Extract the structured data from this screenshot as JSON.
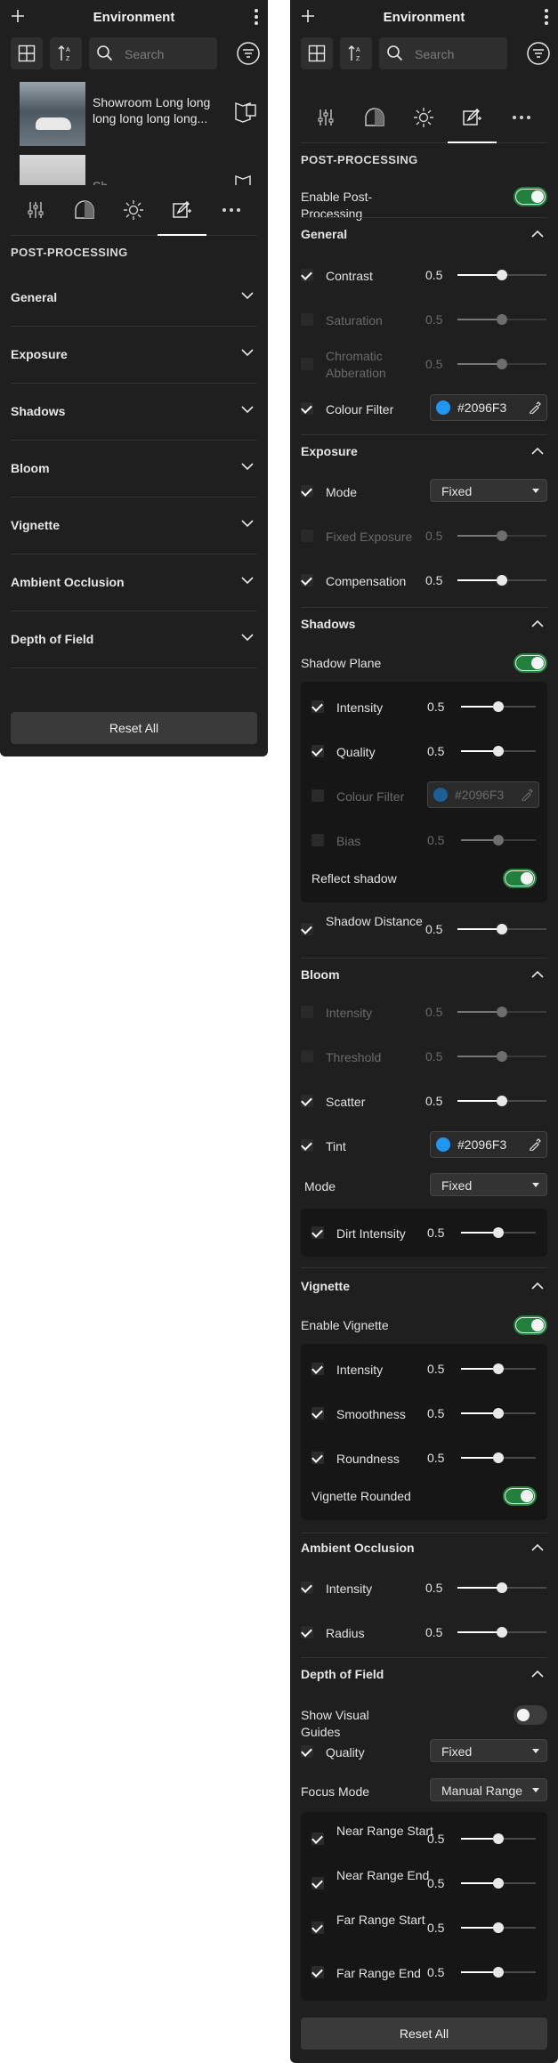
{
  "header": {
    "title": "Environment",
    "search_placeholder": "Search"
  },
  "environment_list": [
    {
      "name": "Showroom Long long long long long long..."
    },
    {
      "name": "Sh..."
    }
  ],
  "section_title": "POST-PROCESSING",
  "left_sections": [
    "General",
    "Exposure",
    "Shadows",
    "Bloom",
    "Vignette",
    "Ambient Occlusion",
    "Depth of Field"
  ],
  "reset_label": "Reset All",
  "right": {
    "enable_pp_label": "Enable Post-Processing",
    "general": {
      "title": "General",
      "rows": [
        {
          "label": "Contrast",
          "value": "0.5",
          "checked": true,
          "enabled": true
        },
        {
          "label": "Saturation",
          "value": "0.5",
          "checked": false,
          "enabled": false
        },
        {
          "label": "Chromatic Abberation",
          "value": "0.5",
          "checked": false,
          "enabled": false
        },
        {
          "label": "Colour Filter",
          "color": "#2096F3",
          "checked": true,
          "enabled": true
        }
      ]
    },
    "exposure": {
      "title": "Exposure",
      "mode_label": "Mode",
      "mode_value": "Fixed",
      "fixed_exposure_label": "Fixed Exposure",
      "fixed_exposure_value": "0.5",
      "compensation_label": "Compensation",
      "compensation_value": "0.5"
    },
    "shadows": {
      "title": "Shadows",
      "plane_label": "Shadow Plane",
      "intensity_label": "Intensity",
      "intensity_value": "0.5",
      "quality_label": "Quality",
      "quality_value": "0.5",
      "colour_filter_label": "Colour Filter",
      "colour_filter_value": "#2096F3",
      "bias_label": "Bias",
      "bias_value": "0.5",
      "reflect_label": "Reflect shadow",
      "distance_label": "Shadow Distance",
      "distance_value": "0.5"
    },
    "bloom": {
      "title": "Bloom",
      "intensity_label": "Intensity",
      "intensity_value": "0.5",
      "threshold_label": "Threshold",
      "threshold_value": "0.5",
      "scatter_label": "Scatter",
      "scatter_value": "0.5",
      "tint_label": "Tint",
      "tint_value": "#2096F3",
      "mode_label": "Mode",
      "mode_value": "Fixed",
      "dirt_label": "Dirt Intensity",
      "dirt_value": "0.5"
    },
    "vignette": {
      "title": "Vignette",
      "enable_label": "Enable Vignette",
      "intensity_label": "Intensity",
      "intensity_value": "0.5",
      "smoothness_label": "Smoothness",
      "smoothness_value": "0.5",
      "roundness_label": "Roundness",
      "roundness_value": "0.5",
      "rounded_label": "Vignette Rounded"
    },
    "ao": {
      "title": "Ambient Occlusion",
      "intensity_label": "Intensity",
      "intensity_value": "0.5",
      "radius_label": "Radius",
      "radius_value": "0.5"
    },
    "dof": {
      "title": "Depth of Field",
      "guides_label": "Show Visual Guides",
      "quality_label": "Quality",
      "quality_value": "Fixed",
      "focus_label": "Focus Mode",
      "focus_value": "Manual Range",
      "near_start_label": "Near Range Start",
      "near_start_value": "0.5",
      "near_end_label": "Near Range End",
      "near_end_value": "0.5",
      "far_start_label": "Far Range Start",
      "far_start_value": "0.5",
      "far_end_label": "Far Range End",
      "far_end_value": "0.5"
    }
  },
  "colors": {
    "accent_green": "#21803c",
    "swatch_blue": "#2096F3",
    "panel_bg": "#1f1f1f"
  },
  "slider_fraction": 0.5
}
